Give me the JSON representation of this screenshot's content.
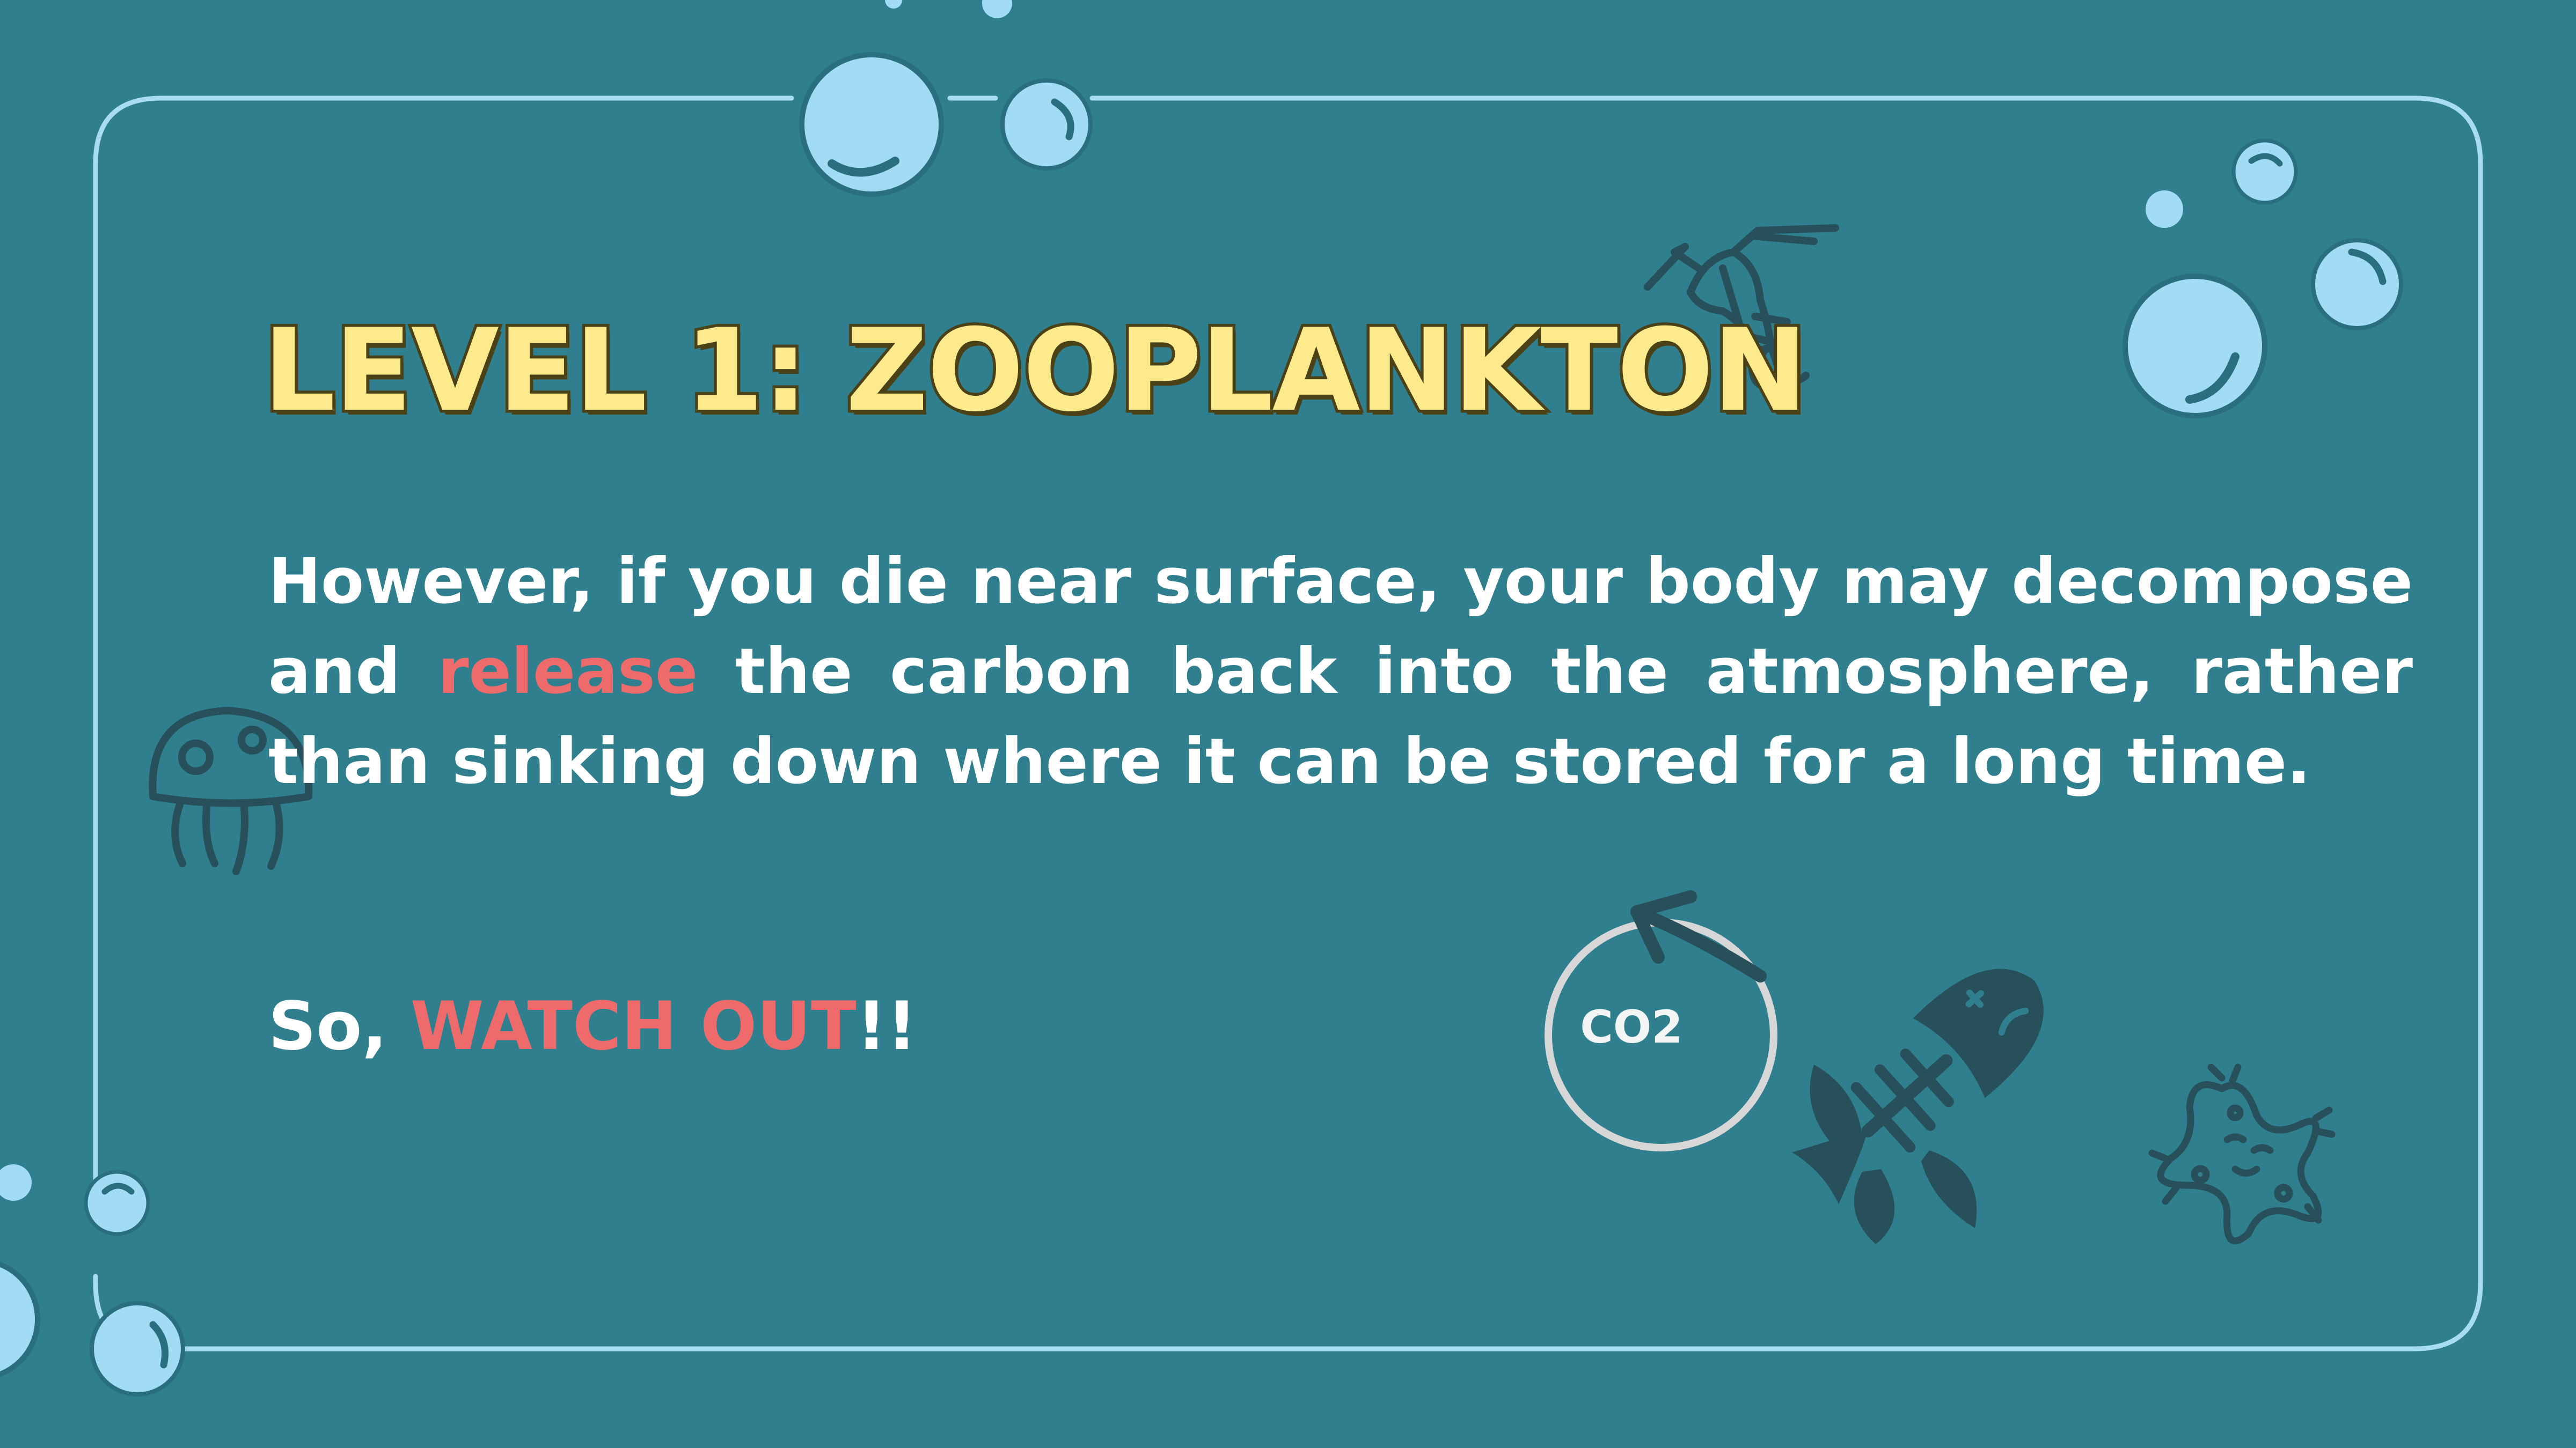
{
  "slide": {
    "title": "LEVEL 1: ZOOPLANKTON",
    "paragraph": {
      "part1": "However, if you die near surface, your body may decompose and ",
      "highlight": "release",
      "part2": " the carbon back into the atmosphere, rather than sinking down where it can be stored for a long time."
    },
    "warning": {
      "prefix": "So, ",
      "highlight": "WATCH OUT",
      "suffix": "!!"
    },
    "co2_label": "CO2"
  },
  "colors": {
    "background": "#2f7f8e",
    "frame": "#a8dcf2",
    "bubble": "#a2dbf4",
    "title_fill": "#fdea8d",
    "title_outline": "#4a4216",
    "highlight": "#ef6a6a",
    "icon": "#27505a"
  },
  "icons": [
    "bubble-icon",
    "shrimp-icon",
    "jellyfish-icon",
    "co2-cycle-icon",
    "fish-skeleton-icon",
    "starfish-icon"
  ]
}
